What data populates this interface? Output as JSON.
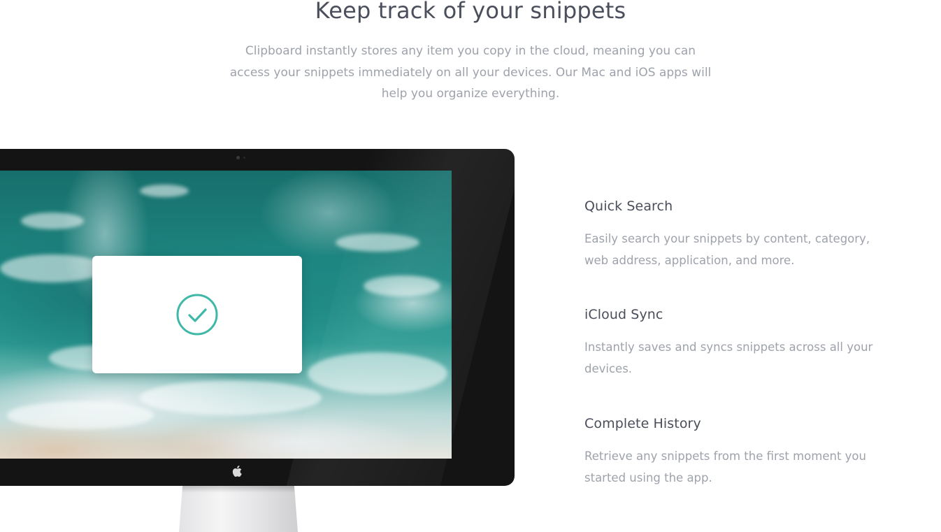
{
  "header": {
    "title": "Keep track of your snippets",
    "subtitle": "Clipboard instantly stores any item you copy in the cloud, meaning you can access your snippets immediately on all your devices. Our Mac and iOS apps will help you organize everything."
  },
  "device": {
    "type": "imac",
    "screen_icon": "checkmark-circle-icon",
    "brand_icon": "apple-logo-icon",
    "accent_color": "#3fb8a8"
  },
  "features": [
    {
      "title": "Quick Search",
      "description": "Easily search your snippets by content, category, web address, application, and more."
    },
    {
      "title": "iCloud Sync",
      "description": "Instantly saves and syncs snippets across all your devices."
    },
    {
      "title": "Complete History",
      "description": "Retrieve any snippets from the first moment you started using the app."
    }
  ]
}
